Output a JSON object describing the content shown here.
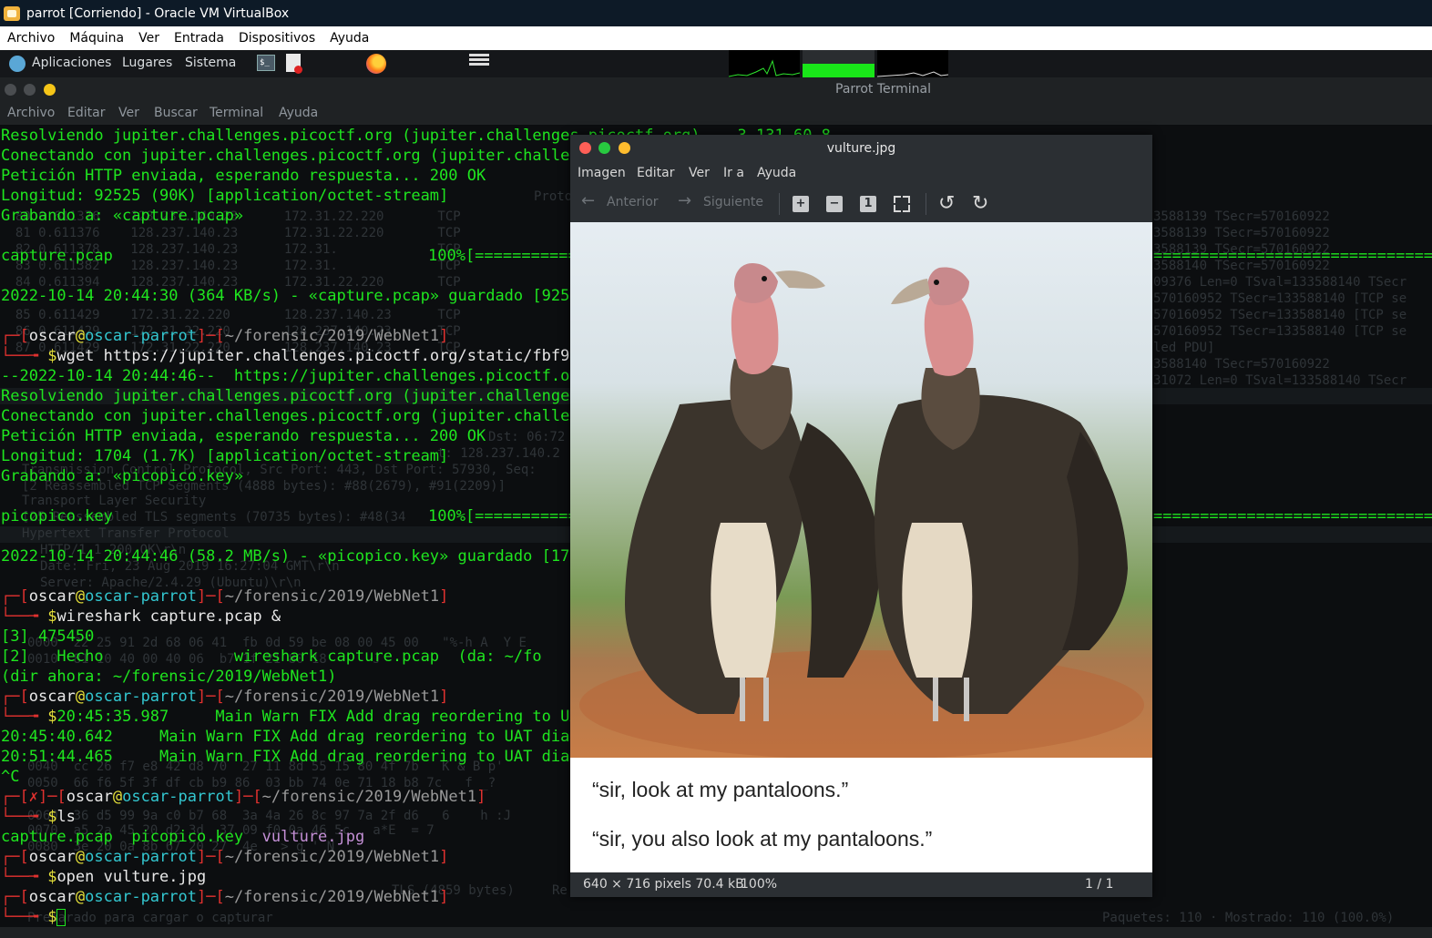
{
  "vbox": {
    "title": "parrot [Corriendo] - Oracle VM VirtualBox",
    "menu": [
      "Archivo",
      "Máquina",
      "Ver",
      "Entrada",
      "Dispositivos",
      "Ayuda"
    ]
  },
  "panel": {
    "menu": [
      "Aplicaciones",
      "Lugares",
      "Sistema"
    ],
    "terminal_icon_text": "$_"
  },
  "terminal": {
    "title": "Parrot Terminal",
    "menu": [
      "Archivo",
      "Editar",
      "Ver",
      "Buscar",
      "Terminal",
      "Ayuda"
    ],
    "lines": {
      "l1": "Resolviendo jupiter.challenges.picoctf.org (jupiter.challenges.picoctf.org)... 3.131.60.8",
      "l2": "Conectando con jupiter.challenges.picoctf.org (jupiter.challeng",
      "l3": "Petición HTTP enviada, esperando respuesta... 200 OK",
      "l4": "Longitud: 92525 (90K) [application/octet-stream]",
      "l5": "Grabando a: «capture.pcap»",
      "l6_name": "capture.pcap",
      "l6_bar": "100%[============",
      "l6_bar_end": "=================================>]  9",
      "l7": "2022-10-14 20:44:30 (364 KB/s) - «capture.pcap» guardado [92525",
      "path": "~/forensic/2019/WebNet1",
      "user": "oscar",
      "at": "@",
      "host": "oscar-parrot",
      "cmd1": "wget https://jupiter.challenges.picoctf.org/static/fbf98e",
      "l9": "--2022-10-14 20:44:46--  https://jupiter.challenges.picoctf.org",
      "l10": "Resolviendo jupiter.challenges.picoctf.org (jupiter.challenges.",
      "l11": "Conectando con jupiter.challenges.picoctf.org (jupiter.challeng",
      "l12": "Petición HTTP enviada, esperando respuesta... 200 OK",
      "l13": "Longitud: 1704 (1.7K) [application/octet-stream]",
      "l14": "Grabando a: «picopico.key»",
      "l15_name": "picopico.key",
      "l15_bar": "100%[============",
      "l15_bar_end": "=================================>]",
      "l16": "2022-10-14 20:44:46 (58.2 MB/s) - «picopico.key» guardado [1704",
      "cmd2": "wireshark capture.pcap &",
      "l18": "[3] 475450",
      "l19": "[2]   Hecho              wireshark capture.pcap  (da: ~/fo",
      "l20": "(dir ahora: ~/forensic/2019/WebNet1)",
      "cmd3": "20:45:35.987     Main Warn FIX Add drag reordering to UAT",
      "l22": "20:45:40.642     Main Warn FIX Add drag reordering to UAT dialo",
      "l23": "20:51:44.465     Main Warn FIX Add drag reordering to UAT dialo",
      "l24": "^C",
      "x_mark": "✗",
      "cmd4": "ls",
      "ls_files": [
        "capture.pcap",
        "picopico.key",
        "vulture.jpg"
      ],
      "cmd5": "open vulture.jpg",
      "prompt_symbol": "$"
    }
  },
  "wireshark_bg": {
    "rows": [
      "Protoc",
      "  80 0.611376    128.237.140.23      172.31.22.220       TCP",
      "  81 0.611376    128.237.140.23      172.31.22.220       TCP",
      "  82 0.611378    128.237.140.23      172.31.             TCP",
      "  83 0.611382    128.237.140.23      172.31.             TCP",
      "  84 0.611394    128.237.140.23      172.31.22.220       TCP",
      "  85 0.611429    172.31.22.220       128.237.140.23      TCP",
      "  86 0.611429    172.31.22.220       128.237.140.23      TCP",
      "  87 0.611429    172.31.22.220       128.237.140.23      TCP"
    ],
    "right_rows": [
      "3588139 TSecr=570160922",
      "3588139 TSecr=570160922",
      "3588139 TSecr=570160922",
      "3588140 TSecr=570160922",
      "09376 Len=0 TSval=133588140 TSecr",
      "570160952 TSecr=133588140 [TCP se",
      "570160952 TSecr=133588140 [TCP se",
      "570160952 TSecr=133588140 [TCP se",
      "led PDU]",
      "3588140 TSecr=570160922",
      "31072 Len=0 TSval=133588140 TSecr"
    ],
    "detail": [
      "Dst: 06:72",
      "t: 128.237.140.2",
      "Transmission Control Protocol, Src Port: 443, Dst Port: 57930, Seq:",
      "[2 Reassembled TCP Segments (4888 bytes): #88(2679), #91(2209)]",
      "Transport Layer Security",
      "[25 Reassembled TLS segments (70735 bytes): #48(34",
      "Hypertext Transfer Protocol",
      "HTTP/1.1 200 OK\\r\\n",
      "Date: Fri, 23 Aug 2019 16:27:04 GMT\\r\\n",
      "Server: Apache/2.4.29 (Ubuntu)\\r\\n"
    ],
    "hex": [
      "0000  22 25 91 2d 68 06 41  fb 0d 59 be 08 00 45 00   \"%-h A  Y E",
      "0010  81 10 40 00 40 06  b7 1f 21 80 18      J",
      "0040  cc 26 f7 e8 42 d8 70  27 11 8d 55 15 80 4f 7b   K & B p'",
      "0050  66 f6 5f 3f df cb b9 86  03 bb 74 0e 71 18 b8 7c   f _?",
      "0060  36 d5 99 9a c0 b7 68  3a 4a 26 8c 97 7a 2f d6   6    h :J",
      "0070  a5 2a 45 20 d2 3d  37 09 f0 0a 46 5c   a*E  = 7",
      "0080  3e 20 0a 8b 67 20 27  4e   > g ' N"
    ],
    "status_left": "Preparado para cargar o capturar",
    "status_right": "Paquetes: 110 · Mostrado: 110 (100.0%)",
    "tls_hint": "TLS (4859 bytes)",
    "re_hint": "Re"
  },
  "viewer": {
    "title": "vulture.jpg",
    "menu": [
      "Imagen",
      "Editar",
      "Ver",
      "Ir a",
      "Ayuda"
    ],
    "back_label": "Anterior",
    "next_label": "Siguiente",
    "one_to_one": "1",
    "caption1": "“sir, look at my pantaloons.”",
    "caption2": "“sir, you also look at my pantaloons.”",
    "status_info": "640 × 716 pixels  70.4 kB",
    "status_zoom": "100%",
    "status_count": "1 / 1"
  },
  "colors": {
    "prompt_red": "#e0312f",
    "host_cyan": "#33c7d0",
    "path_yellow": "#e7e23a",
    "text_green": "#1fe61f",
    "file_magenta": "#c490d6",
    "close_red": "#ff5f57",
    "min_green": "#28c940",
    "max_yellow": "#febc2e"
  }
}
